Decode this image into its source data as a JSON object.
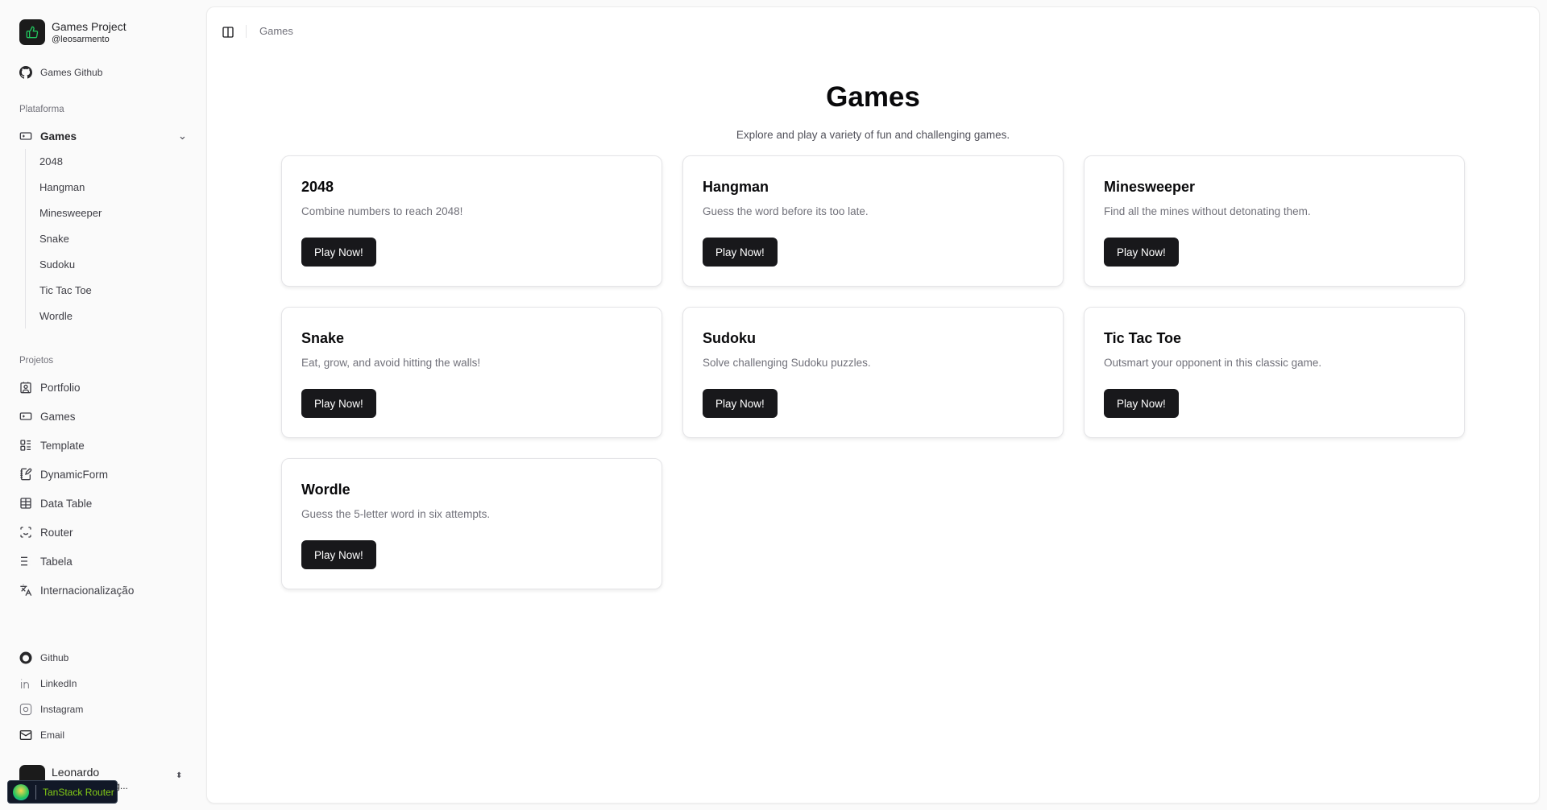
{
  "sidebar": {
    "project_title": "Games Project",
    "project_handle": "@leosarmento",
    "github_link": "Games Github",
    "section_platform": "Plataforma",
    "games_group": "Games",
    "games_items": [
      "2048",
      "Hangman",
      "Minesweeper",
      "Snake",
      "Sudoku",
      "Tic Tac Toe",
      "Wordle"
    ],
    "section_projects": "Projetos",
    "projects": [
      {
        "label": "Portfolio",
        "icon": "contact-icon"
      },
      {
        "label": "Games",
        "icon": "gamepad-icon"
      },
      {
        "label": "Template",
        "icon": "layout-list-icon"
      },
      {
        "label": "DynamicForm",
        "icon": "notebook-pen-icon"
      },
      {
        "label": "Data Table",
        "icon": "table-icon"
      },
      {
        "label": "Router",
        "icon": "scan-face-icon"
      },
      {
        "label": "Tabela",
        "icon": "list-icon"
      },
      {
        "label": "Internacionalização",
        "icon": "languages-icon"
      }
    ],
    "socials": [
      {
        "label": "Github",
        "icon": "github-icon"
      },
      {
        "label": "LinkedIn",
        "icon": "linkedin-icon"
      },
      {
        "label": "Instagram",
        "icon": "instagram-icon"
      },
      {
        "label": "Email",
        "icon": "mail-icon"
      }
    ],
    "user": {
      "name": "Leonardo",
      "email": "leosarmento@g..."
    }
  },
  "header": {
    "breadcrumb": "Games"
  },
  "main": {
    "title": "Games",
    "subtitle": "Explore and play a variety of fun and challenging games.",
    "cards": [
      {
        "title": "2048",
        "description": "Combine numbers to reach 2048!",
        "button": "Play Now!"
      },
      {
        "title": "Hangman",
        "description": "Guess the word before its too late.",
        "button": "Play Now!"
      },
      {
        "title": "Minesweeper",
        "description": "Find all the mines without detonating them.",
        "button": "Play Now!"
      },
      {
        "title": "Snake",
        "description": "Eat, grow, and avoid hitting the walls!",
        "button": "Play Now!"
      },
      {
        "title": "Sudoku",
        "description": "Solve challenging Sudoku puzzles.",
        "button": "Play Now!"
      },
      {
        "title": "Tic Tac Toe",
        "description": "Outsmart your opponent in this classic game.",
        "button": "Play Now!"
      },
      {
        "title": "Wordle",
        "description": "Guess the 5-letter word in six attempts.",
        "button": "Play Now!"
      }
    ]
  },
  "devtools": {
    "label": "TanStack Router"
  },
  "colors": {
    "accent": "#18181b",
    "logo_green": "#22c55e",
    "sidebar_bg": "#fafafa"
  }
}
